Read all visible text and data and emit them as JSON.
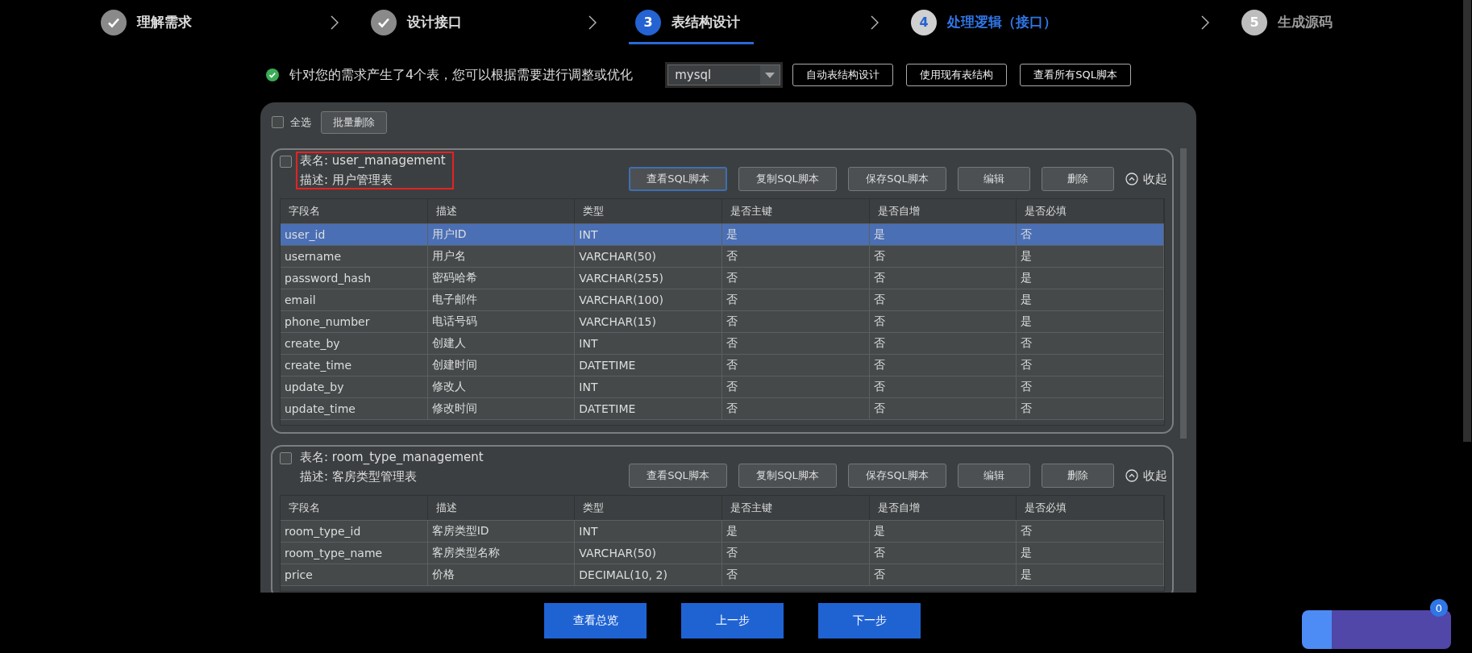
{
  "steps": [
    {
      "label": "理解需求",
      "completed": true,
      "selected": false,
      "highlighted": false
    },
    {
      "label": "设计接口",
      "completed": true,
      "selected": false,
      "highlighted": false
    },
    {
      "number": "3",
      "label": "表结构设计",
      "completed": false,
      "selected": true,
      "highlighted": false
    },
    {
      "number": "4",
      "label": "处理逻辑（接口）",
      "completed": false,
      "selected": false,
      "highlighted": true
    },
    {
      "number": "5",
      "label": "生成源码",
      "completed": false,
      "selected": false,
      "highlighted": false
    }
  ],
  "notice": "针对您的需求产生了4个表，您可以根据需要进行调整或优化",
  "db_select": {
    "value": "mysql"
  },
  "top_buttons": [
    "自动表结构设计",
    "使用现有表结构",
    "查看所有SQL脚本"
  ],
  "toolbar": {
    "select_all": {
      "label": "全选",
      "checked": false
    },
    "batch_delete": "批量删除"
  },
  "tables": [
    {
      "name": "表名: user_management",
      "description": "描述: 用户管理表",
      "checked": false,
      "highlighted": true,
      "actions": [
        {
          "label": "查看SQL脚本",
          "selected": true
        },
        {
          "label": "复制SQL脚本",
          "selected": false
        },
        {
          "label": "保存SQL脚本",
          "selected": false
        },
        {
          "label": "编辑",
          "selected": false
        },
        {
          "label": "删除",
          "selected": false
        }
      ],
      "collapse": "收起",
      "columns": [
        "字段名",
        "描述",
        "类型",
        "是否主键",
        "是否自增",
        "是否必填"
      ],
      "rows": [
        {
          "cells": [
            "user_id",
            "用户ID",
            "INT",
            "是",
            "是",
            "否"
          ],
          "selected": true
        },
        {
          "cells": [
            "username",
            "用户名",
            "VARCHAR(50)",
            "否",
            "否",
            "是"
          ],
          "selected": false
        },
        {
          "cells": [
            "password_hash",
            "密码哈希",
            "VARCHAR(255)",
            "否",
            "否",
            "是"
          ],
          "selected": false
        },
        {
          "cells": [
            "email",
            "电子邮件",
            "VARCHAR(100)",
            "否",
            "否",
            "是"
          ],
          "selected": false
        },
        {
          "cells": [
            "phone_number",
            "电话号码",
            "VARCHAR(15)",
            "否",
            "否",
            "是"
          ],
          "selected": false
        },
        {
          "cells": [
            "create_by",
            "创建人",
            "INT",
            "否",
            "否",
            "否"
          ],
          "selected": false
        },
        {
          "cells": [
            "create_time",
            "创建时间",
            "DATETIME",
            "否",
            "否",
            "否"
          ],
          "selected": false
        },
        {
          "cells": [
            "update_by",
            "修改人",
            "INT",
            "否",
            "否",
            "否"
          ],
          "selected": false
        },
        {
          "cells": [
            "update_time",
            "修改时间",
            "DATETIME",
            "否",
            "否",
            "否"
          ],
          "selected": false
        }
      ]
    },
    {
      "name": "表名: room_type_management",
      "description": "描述: 客房类型管理表",
      "checked": false,
      "highlighted": false,
      "actions": [
        {
          "label": "查看SQL脚本",
          "selected": false
        },
        {
          "label": "复制SQL脚本",
          "selected": false
        },
        {
          "label": "保存SQL脚本",
          "selected": false
        },
        {
          "label": "编辑",
          "selected": false
        },
        {
          "label": "删除",
          "selected": false
        }
      ],
      "collapse": "收起",
      "columns": [
        "字段名",
        "描述",
        "类型",
        "是否主键",
        "是否自增",
        "是否必填"
      ],
      "rows": [
        {
          "cells": [
            "room_type_id",
            "客房类型ID",
            "INT",
            "是",
            "是",
            "否"
          ],
          "selected": false
        },
        {
          "cells": [
            "room_type_name",
            "客房类型名称",
            "VARCHAR(50)",
            "否",
            "否",
            "是"
          ],
          "selected": false
        },
        {
          "cells": [
            "price",
            "价格",
            "DECIMAL(10, 2)",
            "否",
            "否",
            "是"
          ],
          "selected": false
        }
      ]
    }
  ],
  "bottom_buttons": [
    "查看总览",
    "上一步",
    "下一步"
  ],
  "floating_badge": "0"
}
